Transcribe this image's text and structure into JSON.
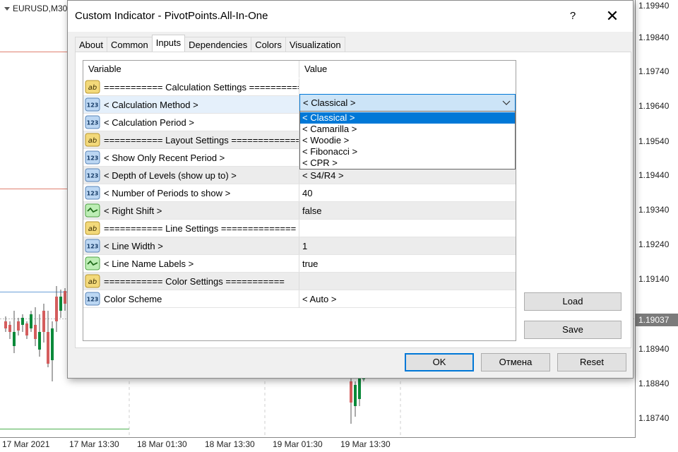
{
  "chart": {
    "symbol": "EURUSD,M30",
    "price_labels": [
      "1.19940",
      "1.19840",
      "1.19740",
      "1.19640",
      "1.19540",
      "1.19440",
      "1.19340",
      "1.19240",
      "1.19140",
      "1.18940",
      "1.18840",
      "1.18740"
    ],
    "current_price": "1.19037",
    "time_labels": [
      "17 Mar 2021",
      "17 Mar 13:30",
      "18 Mar 01:30",
      "18 Mar 13:30",
      "19 Mar 01:30",
      "19 Mar 13:30"
    ],
    "colors": {
      "up": "#0b8a3a",
      "down": "#d45d5d",
      "grid": "#d0d0d0"
    }
  },
  "dialog": {
    "title": "Custom Indicator - PivotPoints.All-In-One",
    "help_glyph": "?",
    "close_glyph": "✕",
    "tabs": [
      {
        "label": "About",
        "active": false
      },
      {
        "label": "Common",
        "active": false
      },
      {
        "label": "Inputs",
        "active": true
      },
      {
        "label": "Dependencies",
        "active": false
      },
      {
        "label": "Colors",
        "active": false
      },
      {
        "label": "Visualization",
        "active": false
      }
    ],
    "grid": {
      "headers": {
        "variable": "Variable",
        "value": "Value"
      },
      "rows": [
        {
          "icon": "ab-icon",
          "variable": "=========== Calculation Settings ==========...",
          "value": ""
        },
        {
          "icon": "123-icon",
          "variable": "< Calculation Method >",
          "value": "< Classical >"
        },
        {
          "icon": "123-icon",
          "variable": "< Calculation Period >",
          "value": ""
        },
        {
          "icon": "ab-icon",
          "variable": "=========== Layout Settings ==============",
          "value": ""
        },
        {
          "icon": "123-icon",
          "variable": "< Show Only Recent Period >",
          "value": ""
        },
        {
          "icon": "123-icon",
          "variable": "< Depth of Levels (show up to) >",
          "value": "< S4/R4 >"
        },
        {
          "icon": "123-icon",
          "variable": "< Number of Periods to show >",
          "value": "40"
        },
        {
          "icon": "bool-icon",
          "variable": "< Right Shift >",
          "value": "false"
        },
        {
          "icon": "ab-icon",
          "variable": "=========== Line Settings ==============",
          "value": ""
        },
        {
          "icon": "123-icon",
          "variable": "< Line Width >",
          "value": "1"
        },
        {
          "icon": "bool-icon",
          "variable": "< Line Name Labels >",
          "value": "true"
        },
        {
          "icon": "ab-icon",
          "variable": "=========== Color Settings ===========",
          "value": ""
        },
        {
          "icon": "123-icon",
          "variable": "Color Scheme",
          "value": "< Auto >"
        }
      ]
    },
    "select": {
      "selected": "< Classical >",
      "options": [
        "< Classical >",
        "< Camarilla >",
        "< Woodie >",
        "< Fibonacci >",
        "< CPR >"
      ]
    },
    "buttons": {
      "load": "Load",
      "save": "Save",
      "ok": "OK",
      "cancel": "Отмена",
      "reset": "Reset"
    },
    "accent": "#0078d7"
  }
}
